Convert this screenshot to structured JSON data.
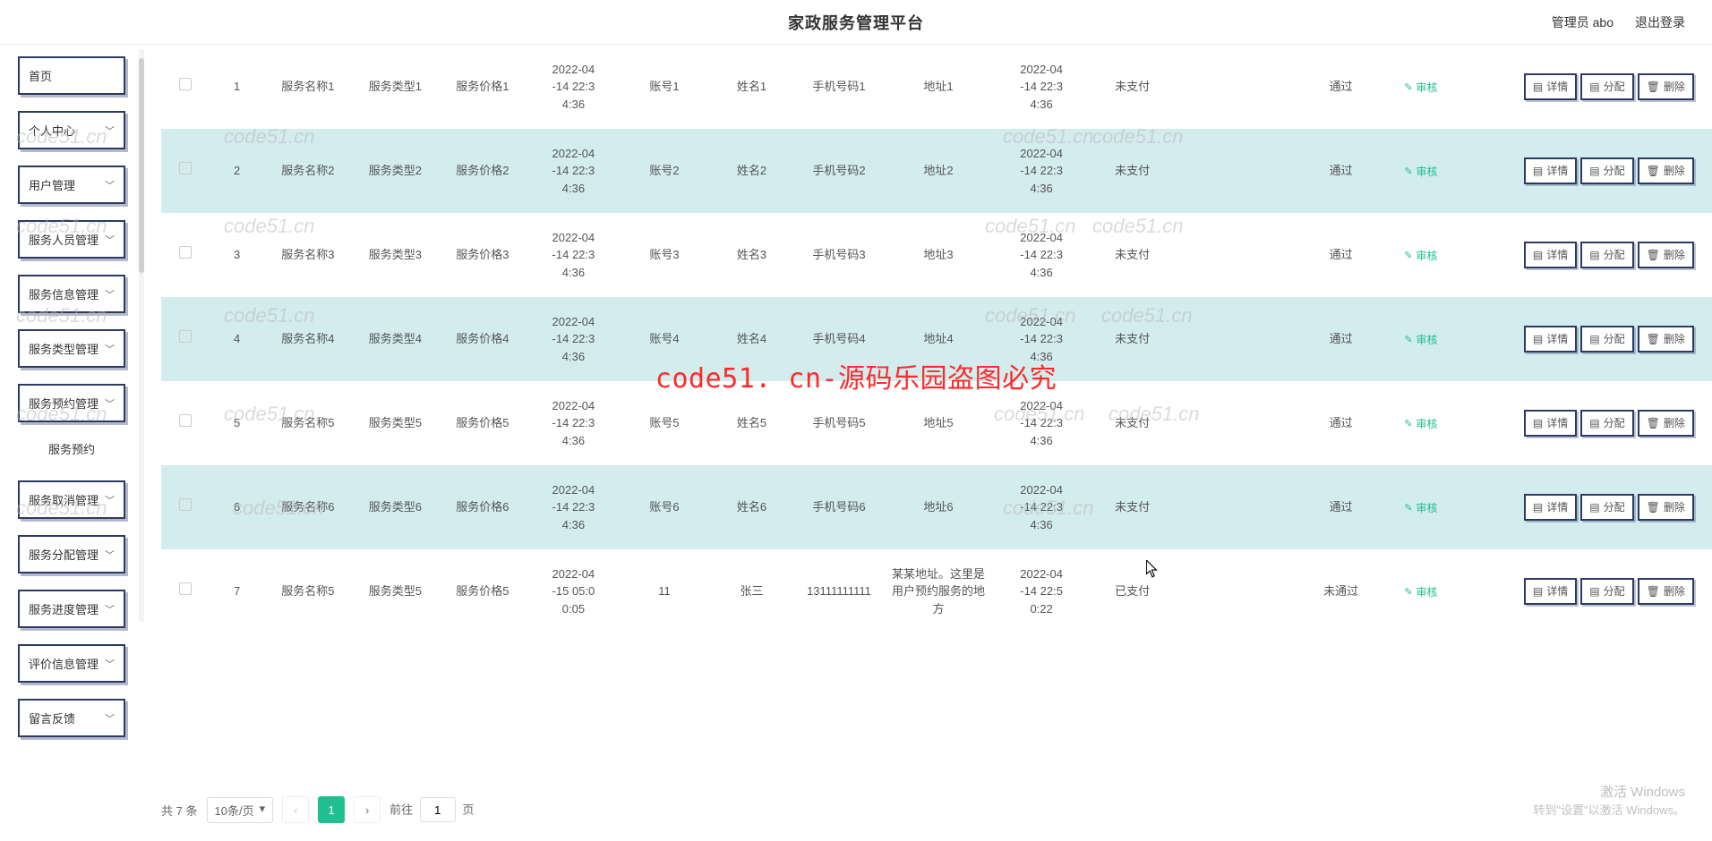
{
  "header": {
    "title": "家政服务管理平台",
    "user_prefix": "管理员",
    "username": "abo",
    "logout": "退出登录"
  },
  "sidebar": {
    "items": [
      {
        "label": "首页",
        "expandable": false
      },
      {
        "label": "个人中心",
        "expandable": true
      },
      {
        "label": "用户管理",
        "expandable": true
      },
      {
        "label": "服务人员管理",
        "expandable": true
      },
      {
        "label": "服务信息管理",
        "expandable": true
      },
      {
        "label": "服务类型管理",
        "expandable": true
      },
      {
        "label": "服务预约管理",
        "expandable": true,
        "sub": "服务预约"
      },
      {
        "label": "服务取消管理",
        "expandable": true
      },
      {
        "label": "服务分配管理",
        "expandable": true
      },
      {
        "label": "服务进度管理",
        "expandable": true
      },
      {
        "label": "评价信息管理",
        "expandable": true
      },
      {
        "label": "留言反馈",
        "expandable": true
      }
    ]
  },
  "table": {
    "rows": [
      {
        "idx": "1",
        "name": "服务名称1",
        "type": "服务类型1",
        "price": "服务价格1",
        "t1": "2022-04-14 22:34:36",
        "acct": "账号1",
        "uname": "姓名1",
        "phone": "手机号码1",
        "addr": "地址1",
        "t2": "2022-04-14 22:34:36",
        "pay": "未支付",
        "pass": "通过"
      },
      {
        "idx": "2",
        "name": "服务名称2",
        "type": "服务类型2",
        "price": "服务价格2",
        "t1": "2022-04-14 22:34:36",
        "acct": "账号2",
        "uname": "姓名2",
        "phone": "手机号码2",
        "addr": "地址2",
        "t2": "2022-04-14 22:34:36",
        "pay": "未支付",
        "pass": "通过"
      },
      {
        "idx": "3",
        "name": "服务名称3",
        "type": "服务类型3",
        "price": "服务价格3",
        "t1": "2022-04-14 22:34:36",
        "acct": "账号3",
        "uname": "姓名3",
        "phone": "手机号码3",
        "addr": "地址3",
        "t2": "2022-04-14 22:34:36",
        "pay": "未支付",
        "pass": "通过"
      },
      {
        "idx": "4",
        "name": "服务名称4",
        "type": "服务类型4",
        "price": "服务价格4",
        "t1": "2022-04-14 22:34:36",
        "acct": "账号4",
        "uname": "姓名4",
        "phone": "手机号码4",
        "addr": "地址4",
        "t2": "2022-04-14 22:34:36",
        "pay": "未支付",
        "pass": "通过"
      },
      {
        "idx": "5",
        "name": "服务名称5",
        "type": "服务类型5",
        "price": "服务价格5",
        "t1": "2022-04-14 22:34:36",
        "acct": "账号5",
        "uname": "姓名5",
        "phone": "手机号码5",
        "addr": "地址5",
        "t2": "2022-04-14 22:34:36",
        "pay": "未支付",
        "pass": "通过"
      },
      {
        "idx": "6",
        "name": "服务名称6",
        "type": "服务类型6",
        "price": "服务价格6",
        "t1": "2022-04-14 22:34:36",
        "acct": "账号6",
        "uname": "姓名6",
        "phone": "手机号码6",
        "addr": "地址6",
        "t2": "2022-04-14 22:34:36",
        "pay": "未支付",
        "pass": "通过"
      },
      {
        "idx": "7",
        "name": "服务名称5",
        "type": "服务类型5",
        "price": "服务价格5",
        "t1": "2022-04-15 05:00:05",
        "acct": "11",
        "uname": "张三",
        "phone": "13111111111",
        "addr": "某某地址。这里是用户预约服务的地方",
        "t2": "2022-04-14 22:50:22",
        "pay": "已支付",
        "pass": "未通过"
      }
    ],
    "audit_label": "审核",
    "actions": {
      "detail": "详情",
      "assign": "分配",
      "delete": "删除"
    }
  },
  "pagination": {
    "total_prefix": "共",
    "total": "7",
    "total_suffix": "条",
    "page_size": "10条/页",
    "current": "1",
    "goto_prefix": "前往",
    "goto_val": "1",
    "goto_suffix": "页"
  },
  "watermark_text": "code51.cn",
  "watermark_red": "code51. cn-源码乐园盗图必究",
  "activate": {
    "l1": "激活 Windows",
    "l2": "转到\"设置\"以激活 Windows。"
  }
}
